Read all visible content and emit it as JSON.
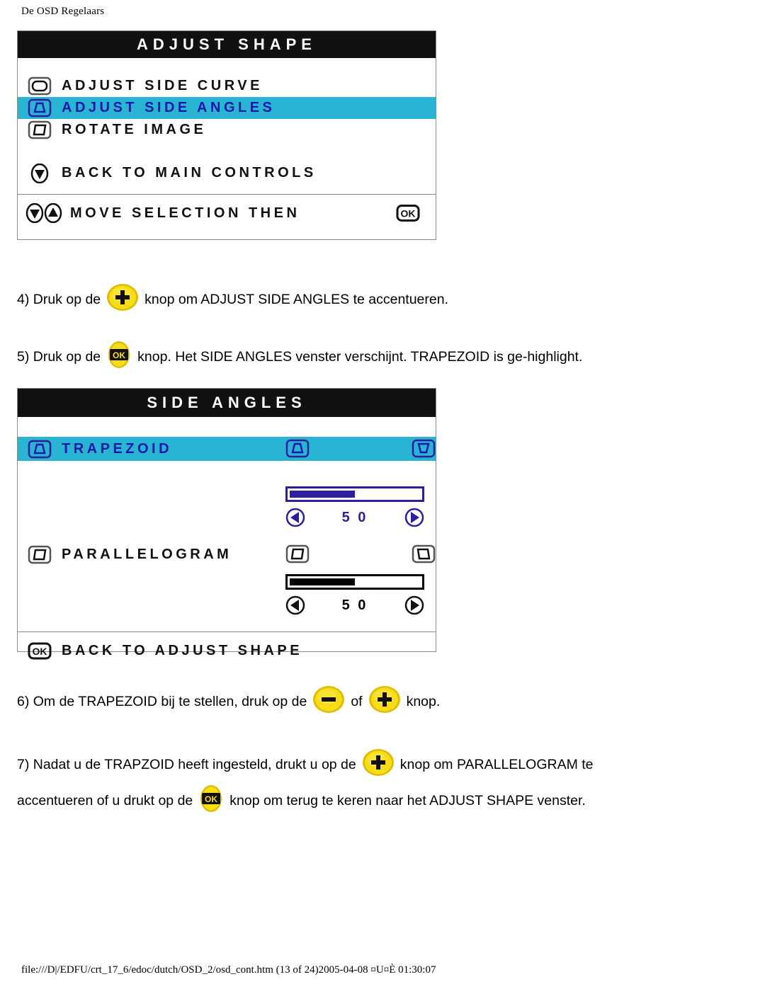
{
  "page": {
    "header": "De OSD Regelaars",
    "footer": "file:///D|/EDFU/crt_17_6/edoc/dutch/OSD_2/osd_cont.htm (13 of 24)2005-04-08 ¤U¤È 01:30:07"
  },
  "colors": {
    "highlight": "#29b4d4",
    "highlight_text": "#1a18a8",
    "title_bg": "#111111",
    "title_text": "#ffffff",
    "slider_blue": "#2b1f9e",
    "slider_black": "#000000",
    "button_yellow": "#f5d400",
    "panel_border": "#8a8a8a"
  },
  "osd_adjust_shape": {
    "title": "ADJUST SHAPE",
    "items": [
      {
        "label": "ADJUST SIDE CURVE",
        "icon": "monitor-rounded-icon",
        "highlighted": false
      },
      {
        "label": "ADJUST SIDE ANGLES",
        "icon": "monitor-trapezoid-icon",
        "highlighted": true
      },
      {
        "label": "ROTATE IMAGE",
        "icon": "monitor-rotate-icon",
        "highlighted": false
      }
    ],
    "back_item": {
      "label": "BACK TO MAIN CONTROLS",
      "icon": "circle-down-arrow-icon"
    },
    "footer_item": {
      "label": "MOVE SELECTION THEN",
      "icons": [
        "circle-down-arrow-icon",
        "circle-up-arrow-icon"
      ],
      "confirm_icon": "ok-glyph-icon"
    }
  },
  "osd_side_angles": {
    "title": "SIDE ANGLES",
    "controls": [
      {
        "label": "TRAPEZOID",
        "icon": "monitor-trapezoid-icon",
        "highlighted": true,
        "left_preview_icon": "monitor-trapezoid-wide-top-icon",
        "right_preview_icon": "monitor-trapezoid-narrow-top-icon",
        "value": "5 0",
        "fill_percent": 50,
        "style": "blue",
        "dec_icon": "circle-left-arrow-icon",
        "inc_icon": "circle-right-arrow-icon"
      },
      {
        "label": "PARALLELOGRAM",
        "icon": "monitor-rotate-icon",
        "highlighted": false,
        "left_preview_icon": "monitor-parallelogram-left-icon",
        "right_preview_icon": "monitor-parallelogram-right-icon",
        "value": "5 0",
        "fill_percent": 50,
        "style": "black",
        "dec_icon": "circle-left-arrow-icon",
        "inc_icon": "circle-right-arrow-icon"
      }
    ],
    "footer_item": {
      "label": "BACK TO ADJUST SHAPE",
      "icon": "ok-glyph-icon"
    }
  },
  "instructions": [
    {
      "id": "step-4",
      "parts": [
        {
          "type": "text",
          "value": "4) Druk op de"
        },
        {
          "type": "button",
          "icon": "plus-button-icon"
        },
        {
          "type": "text",
          "value": "knop om ADJUST SIDE ANGLES te accentueren."
        }
      ]
    },
    {
      "id": "step-5",
      "parts": [
        {
          "type": "text",
          "value": "5) Druk op de"
        },
        {
          "type": "button",
          "icon": "ok-button-icon"
        },
        {
          "type": "text",
          "value": "knop. Het SIDE ANGLES venster verschijnt. TRAPEZOID is ge-highlight."
        }
      ]
    },
    {
      "id": "step-6",
      "parts": [
        {
          "type": "text",
          "value": "6) Om de TRAPEZOID bij te stellen, druk op de"
        },
        {
          "type": "button",
          "icon": "minus-button-icon"
        },
        {
          "type": "text",
          "value": "of"
        },
        {
          "type": "button",
          "icon": "plus-button-icon"
        },
        {
          "type": "text",
          "value": "knop."
        }
      ]
    },
    {
      "id": "step-7-line-1",
      "parts": [
        {
          "type": "text",
          "value": "7) Nadat u de TRAPZOID heeft ingesteld, drukt u op de"
        },
        {
          "type": "button",
          "icon": "plus-button-icon"
        },
        {
          "type": "text",
          "value": "knop om PARALLELOGRAM te"
        }
      ]
    },
    {
      "id": "step-7-line-2",
      "parts": [
        {
          "type": "text",
          "value": "accentueren of u drukt op de"
        },
        {
          "type": "button",
          "icon": "ok-button-icon"
        },
        {
          "type": "text",
          "value": "knop om terug te keren naar het ADJUST SHAPE venster."
        }
      ]
    }
  ]
}
